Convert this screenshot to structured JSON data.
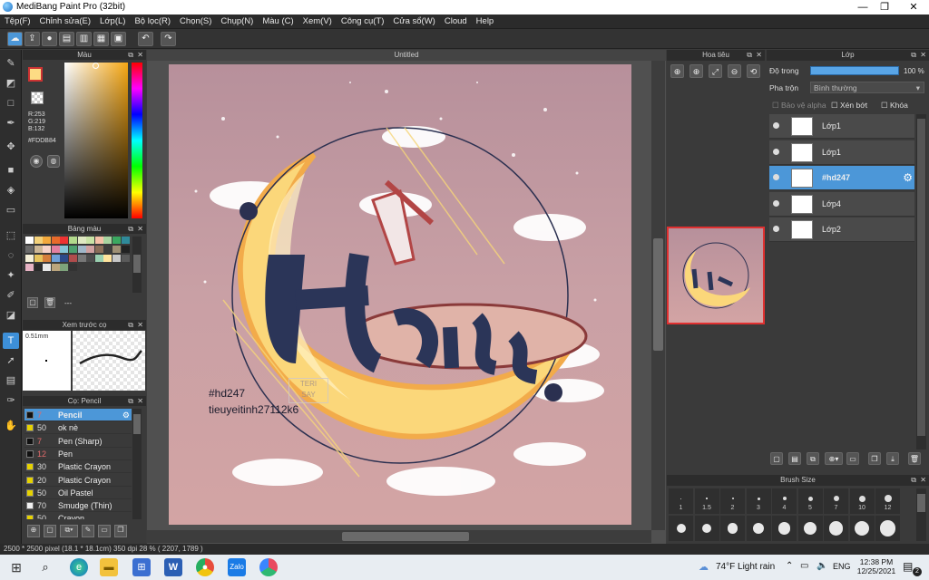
{
  "window": {
    "title": "MediBang Paint Pro (32bit)",
    "min": "—",
    "max": "❐",
    "close": "✕"
  },
  "menu": [
    "Tệp(F)",
    "Chỉnh sửa(E)",
    "Lớp(L)",
    "Bộ lọc(R)",
    "Chọn(S)",
    "Chụp(N)",
    "Màu (C)",
    "Xem(V)",
    "Công cụ(T)",
    "Cửa sổ(W)",
    "Cloud",
    "Help"
  ],
  "document": {
    "tab": "Untitled",
    "watermark": "#hd247",
    "watermark2": "tieuyeitinh27112k6",
    "stamp1": "TERI",
    "stamp2": "SAY"
  },
  "color_panel": {
    "title": "Màu",
    "r": "R:253",
    "g": "G:219",
    "b": "B:132",
    "hex": "#FDDB84",
    "primary": "#FDDB84"
  },
  "swatch_panel": {
    "title": "Bảng màu",
    "add_label": "---"
  },
  "preview_panel": {
    "title": "Xem trước cọ",
    "size": "0.51mm"
  },
  "brush_list": {
    "title": "Cọ: Pencil",
    "items": [
      {
        "size": "7",
        "name": "Pencil",
        "color": "#111"
      },
      {
        "size": "50",
        "name": "ok nè",
        "color": "#e6d200"
      },
      {
        "size": "7",
        "name": "Pen (Sharp)",
        "color": "#111"
      },
      {
        "size": "12",
        "name": "Pen",
        "color": "#111"
      },
      {
        "size": "30",
        "name": "Plastic Crayon (thick)",
        "color": "#e6d200"
      },
      {
        "size": "20",
        "name": "Plastic Crayon",
        "color": "#e6d200"
      },
      {
        "size": "50",
        "name": "Oil Pastel",
        "color": "#e6d200"
      },
      {
        "size": "70",
        "name": "Smudge (Thin)",
        "color": "#f0f0f0"
      },
      {
        "size": "50",
        "name": "Crayon",
        "color": "#e6d200"
      }
    ]
  },
  "navigator": {
    "title": "Hoa tiêu"
  },
  "layers": {
    "title": "Lớp",
    "opacity_label": "Độ trong",
    "opacity_value": "100 %",
    "blend_label": "Pha trộn",
    "blend_value": "Bình thường",
    "protect_alpha": "Bảo vệ alpha",
    "clip": "Xén bớt",
    "lock": "Khóa",
    "items": [
      {
        "name": "Lớp1",
        "selected": false
      },
      {
        "name": "Lớp1",
        "selected": false
      },
      {
        "name": "#hd247",
        "selected": true
      },
      {
        "name": "Lớp4",
        "selected": false
      },
      {
        "name": "Lớp2",
        "selected": false
      }
    ]
  },
  "brush_size": {
    "title": "Brush Size",
    "sizes": [
      "1",
      "1.5",
      "2",
      "3",
      "4",
      "5",
      "7",
      "10",
      "12"
    ]
  },
  "status": {
    "text": "2500 * 2500 pixel  (18.1 * 18.1cm)  350 dpi   28 %  ( 2207, 1789 )"
  },
  "taskbar": {
    "weather": "74°F  Light rain",
    "lang": "ENG",
    "time": "12:38 PM",
    "date": "12/25/2021",
    "notif": "2"
  }
}
